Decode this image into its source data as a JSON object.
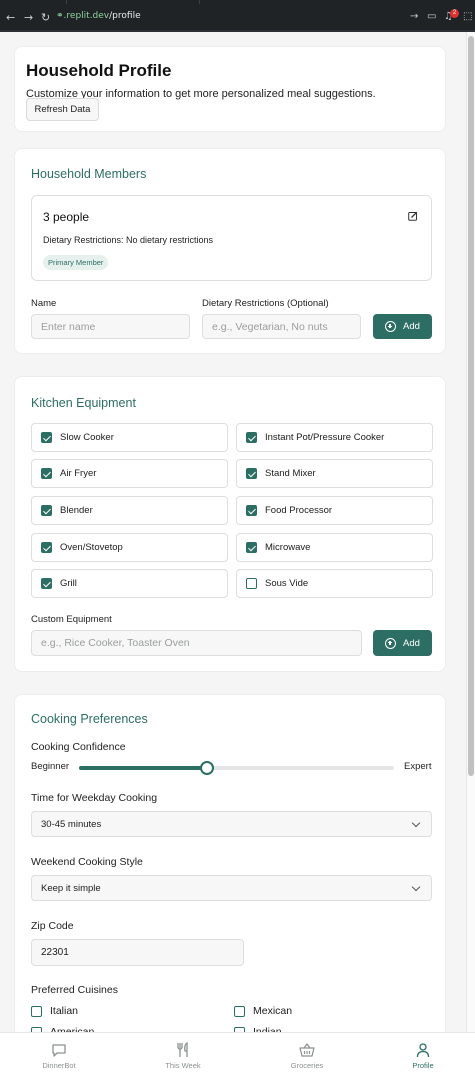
{
  "browser": {
    "url_host": ".replit.dev",
    "url_path": "/profile",
    "notification_count": "2"
  },
  "header": {
    "title": "Household Profile",
    "subtitle": "Customize your information to get more personalized meal suggestions.",
    "refresh_label": "Refresh Data"
  },
  "household": {
    "title": "Household Members",
    "member": {
      "name": "3 people",
      "dietary": "Dietary Restrictions: No dietary restrictions",
      "badge": "Primary Member"
    },
    "name_label": "Name",
    "name_placeholder": "Enter name",
    "diet_label": "Dietary Restrictions (Optional)",
    "diet_placeholder": "e.g., Vegetarian, No nuts",
    "add_label": "Add"
  },
  "kitchen": {
    "title": "Kitchen Equipment",
    "items": [
      {
        "label": "Slow Cooker",
        "checked": true
      },
      {
        "label": "Instant Pot/Pressure Cooker",
        "checked": true
      },
      {
        "label": "Air Fryer",
        "checked": true
      },
      {
        "label": "Stand Mixer",
        "checked": true
      },
      {
        "label": "Blender",
        "checked": true
      },
      {
        "label": "Food Processor",
        "checked": true
      },
      {
        "label": "Oven/Stovetop",
        "checked": true
      },
      {
        "label": "Microwave",
        "checked": true
      },
      {
        "label": "Grill",
        "checked": true
      },
      {
        "label": "Sous Vide",
        "checked": false
      }
    ],
    "custom_label": "Custom Equipment",
    "custom_placeholder": "e.g., Rice Cooker, Toaster Oven",
    "add_label": "Add"
  },
  "cooking": {
    "title": "Cooking Preferences",
    "confidence_label": "Cooking Confidence",
    "confidence_min": "Beginner",
    "confidence_max": "Expert",
    "confidence_value": 0.405,
    "weekday_label": "Time for Weekday Cooking",
    "weekday_value": "30-45 minutes",
    "weekend_label": "Weekend Cooking Style",
    "weekend_value": "Keep it simple",
    "zip_label": "Zip Code",
    "zip_value": "22301",
    "cuisines_label": "Preferred Cuisines",
    "cuisines": [
      {
        "label": "Italian",
        "checked": false
      },
      {
        "label": "Mexican",
        "checked": false
      },
      {
        "label": "American",
        "checked": false
      },
      {
        "label": "Indian",
        "checked": false
      }
    ]
  },
  "bottom_nav": {
    "items": [
      {
        "label": "DinnerBot",
        "icon": "chat-icon",
        "active": false
      },
      {
        "label": "This Week",
        "icon": "utensils-icon",
        "active": false
      },
      {
        "label": "Groceries",
        "icon": "basket-icon",
        "active": false
      },
      {
        "label": "Profile",
        "icon": "user-icon",
        "active": true
      }
    ]
  },
  "colors": {
    "accent": "#2d6e64",
    "badge_bg": "#e6f1ed",
    "notification": "#e0312f"
  }
}
